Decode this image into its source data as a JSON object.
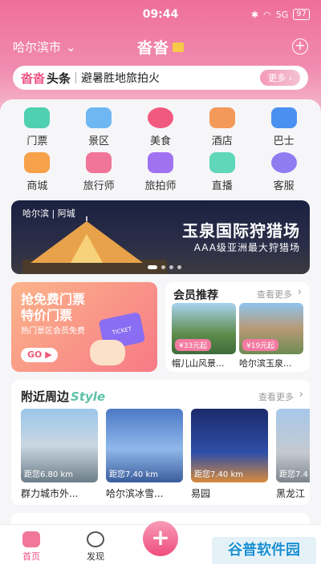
{
  "status_bar": {
    "time": "09:44",
    "signal": "5G",
    "battery": "97"
  },
  "header": {
    "city": "哈尔滨市",
    "title": "沓沓"
  },
  "headline": {
    "brand_a": "沓沓",
    "brand_b": "头条",
    "text": "避暑胜地旅拍火",
    "more": "更多"
  },
  "categories": [
    {
      "label": "门票",
      "color": "#4fd0b1"
    },
    {
      "label": "景区",
      "color": "#6fb7f2"
    },
    {
      "label": "美食",
      "color": "#f2597e"
    },
    {
      "label": "酒店",
      "color": "#f39a5a"
    },
    {
      "label": "巴士",
      "color": "#4a90f0"
    },
    {
      "label": "商城",
      "color": "#f7a14a"
    },
    {
      "label": "旅行师",
      "color": "#f07598"
    },
    {
      "label": "旅拍师",
      "color": "#a072f2"
    },
    {
      "label": "直播",
      "color": "#5fd7b8"
    },
    {
      "label": "客服",
      "color": "#8f7cf0"
    }
  ],
  "banner": {
    "location": "哈尔滨 | 阿城",
    "title": "玉泉国际狩猎场",
    "subtitle": "AAA级亚洲最大狩猎场"
  },
  "promo": {
    "line1": "抢免费门票",
    "line2": "特价门票",
    "line3": "热门景区会员免费",
    "go": "GO",
    "ticket": "TICKET"
  },
  "member": {
    "title": "会员推荐",
    "more": "查看更多",
    "items": [
      {
        "price": "¥33元起",
        "name": "帽儿山风景..."
      },
      {
        "price": "¥19元起",
        "name": "哈尔滨玉泉..."
      }
    ]
  },
  "nearby": {
    "title": "附近周边",
    "title_style": "Style",
    "more": "查看更多",
    "items": [
      {
        "distance": "距您6.80 km",
        "name": "群力城市外..."
      },
      {
        "distance": "距您7.40 km",
        "name": "哈尔滨冰雪..."
      },
      {
        "distance": "距您7.40 km",
        "name": "易园"
      },
      {
        "distance": "距您7.4",
        "name": "黑龙江"
      }
    ]
  },
  "bottom_nav": {
    "home": "首页",
    "discover": "发现",
    "plus": "+"
  },
  "watermark": "谷普软件园"
}
